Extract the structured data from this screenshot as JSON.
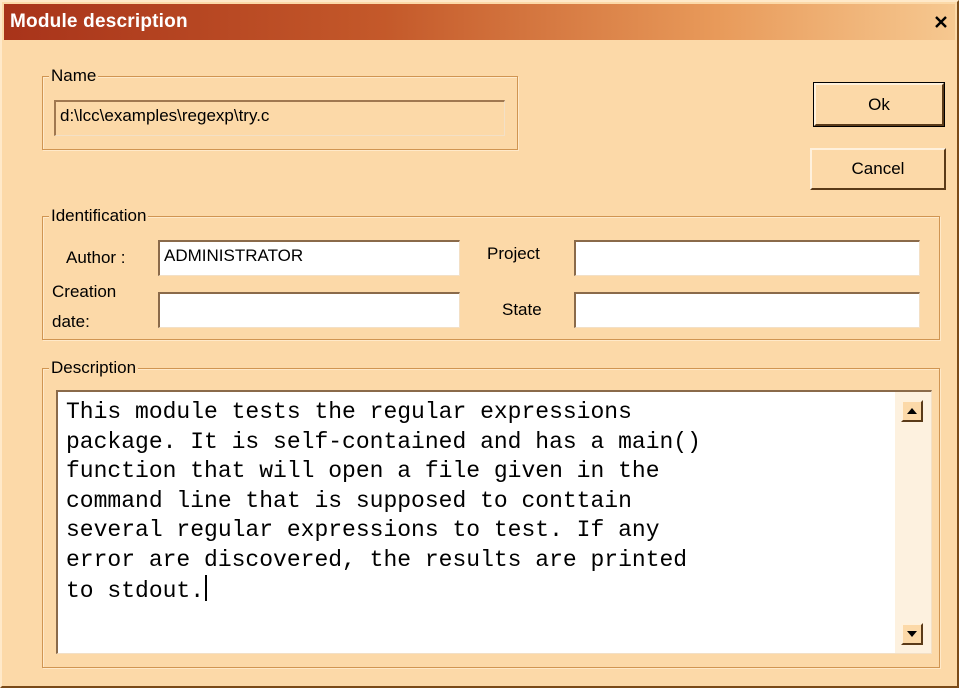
{
  "window": {
    "title": "Module description",
    "close_glyph": "×"
  },
  "name_group": {
    "legend": "Name",
    "path_value": "d:\\lcc\\examples\\regexp\\try.c"
  },
  "buttons": {
    "ok_label": "Ok",
    "cancel_label": "Cancel"
  },
  "identification": {
    "legend": "Identification",
    "author_label": "Author :",
    "author_value": "ADMINISTRATOR",
    "creation_label_line1": "Creation",
    "creation_label_line2": "date:",
    "creation_value": "",
    "project_label": "Project",
    "project_value": "",
    "state_label": "State",
    "state_value": ""
  },
  "description": {
    "legend": "Description",
    "text": "This module tests the regular expressions\npackage. It is self-contained and has a main()\nfunction that will open a file given in the\ncommand line that is supposed to conttain\nseveral regular expressions to test. If any\nerror are discovered, the results are printed\nto stdout."
  },
  "icons": {
    "close": "close-icon",
    "scroll_up": "scroll-up-arrow-icon",
    "scroll_down": "scroll-down-arrow-icon"
  },
  "colors": {
    "dialog_background": "#fcd9a8",
    "titlebar_start": "#a8331a",
    "titlebar_end": "#f6c890",
    "title_text": "#ffffff"
  }
}
